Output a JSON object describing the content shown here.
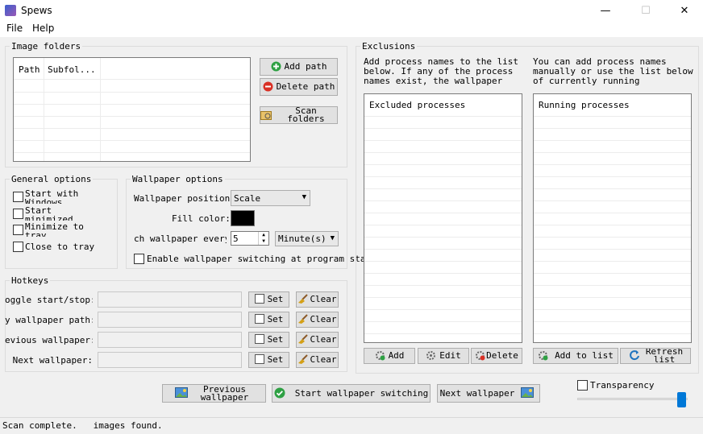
{
  "window": {
    "title": "Spews",
    "minimize": "—",
    "maximize": "☐",
    "close": "✕"
  },
  "menu": {
    "file": "File",
    "help": "Help"
  },
  "image_folders": {
    "title": "Image folders",
    "col_path": "Path",
    "col_subfolders": "Subfol...",
    "add_path": "Add path",
    "delete_path": "Delete path",
    "scan_folders": "Scan folders"
  },
  "general_options": {
    "title": "General options",
    "start_with_windows": "Start with Windows",
    "start_minimized": "Start minimized",
    "minimize_to_tray": "Minimize to tray",
    "close_to_tray": "Close to tray"
  },
  "wallpaper_options": {
    "title": "Wallpaper options",
    "position_label": "Wallpaper position:",
    "position_value": "Scale",
    "fill_color_label": "Fill color:",
    "fill_color": "#000000",
    "switch_every_label": "ch wallpaper every:",
    "switch_every_value": "5",
    "unit_value": "Minute(s)",
    "enable_switching": "Enable wallpaper switching at program startup"
  },
  "hotkeys": {
    "title": "Hotkeys",
    "rows": [
      {
        "label": "oggle start/stop:",
        "set": "Set",
        "clear": "Clear"
      },
      {
        "label": "y wallpaper path:",
        "set": "Set",
        "clear": "Clear"
      },
      {
        "label": "evious wallpaper:",
        "set": "Set",
        "clear": "Clear"
      },
      {
        "label": "Next wallpaper:",
        "set": "Set",
        "clear": "Clear"
      }
    ]
  },
  "exclusions": {
    "title": "Exclusions",
    "left_desc": "Add process names to the list below.  If any of the process names exist, the wallpaper will",
    "right_desc": "You can add process names manually or use the list below of currently running processes.",
    "excluded_header": "Excluded processes",
    "running_header": "Running processes",
    "add": "Add",
    "edit": "Edit",
    "delete": "Delete",
    "add_to_list": "Add to list",
    "refresh_list": "Refresh list"
  },
  "bottom": {
    "previous_wallpaper": "Previous wallpaper",
    "start_switching": "Start wallpaper switching",
    "next_wallpaper": "Next wallpaper",
    "transparency": "Transparency",
    "transparency_level": 1.0
  },
  "status": {
    "text": "Scan complete.   images found."
  }
}
